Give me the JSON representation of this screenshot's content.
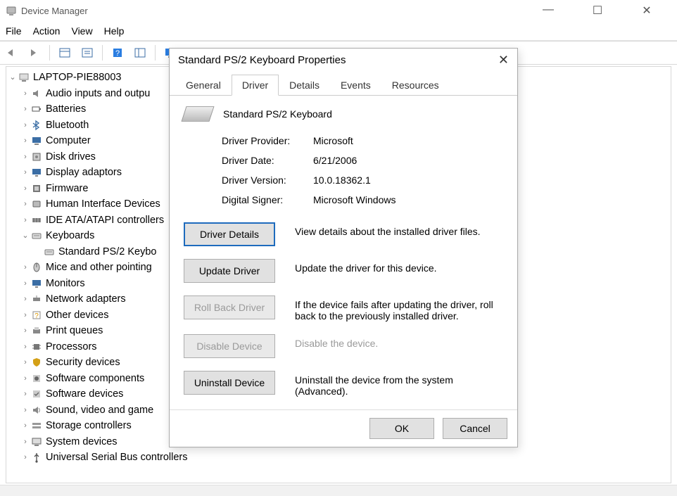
{
  "window": {
    "title": "Device Manager",
    "menus": [
      "File",
      "Action",
      "View",
      "Help"
    ]
  },
  "tree": {
    "root": "LAPTOP-PIE88003",
    "items": [
      "Audio inputs and outpu",
      "Batteries",
      "Bluetooth",
      "Computer",
      "Disk drives",
      "Display adaptors",
      "Firmware",
      "Human Interface Devices",
      "IDE ATA/ATAPI controllers",
      "Keyboards",
      "Mice and other pointing",
      "Monitors",
      "Network adapters",
      "Other devices",
      "Print queues",
      "Processors",
      "Security devices",
      "Software components",
      "Software devices",
      "Sound, video and game",
      "Storage controllers",
      "System devices",
      "Universal Serial Bus controllers"
    ],
    "keyboards_child": "Standard PS/2 Keybo"
  },
  "dialog": {
    "title": "Standard PS/2 Keyboard Properties",
    "tabs": [
      "General",
      "Driver",
      "Details",
      "Events",
      "Resources"
    ],
    "active_tab": "Driver",
    "device_name": "Standard PS/2 Keyboard",
    "info": {
      "provider_label": "Driver Provider:",
      "provider_value": "Microsoft",
      "date_label": "Driver Date:",
      "date_value": "6/21/2006",
      "version_label": "Driver Version:",
      "version_value": "10.0.18362.1",
      "signer_label": "Digital Signer:",
      "signer_value": "Microsoft Windows"
    },
    "actions": {
      "details_btn": "Driver Details",
      "details_desc": "View details about the installed driver files.",
      "update_btn": "Update Driver",
      "update_desc": "Update the driver for this device.",
      "rollback_btn": "Roll Back Driver",
      "rollback_desc": "If the device fails after updating the driver, roll back to the previously installed driver.",
      "disable_btn": "Disable Device",
      "disable_desc": "Disable the device.",
      "uninstall_btn": "Uninstall Device",
      "uninstall_desc": "Uninstall the device from the system (Advanced)."
    },
    "footer": {
      "ok": "OK",
      "cancel": "Cancel"
    }
  }
}
